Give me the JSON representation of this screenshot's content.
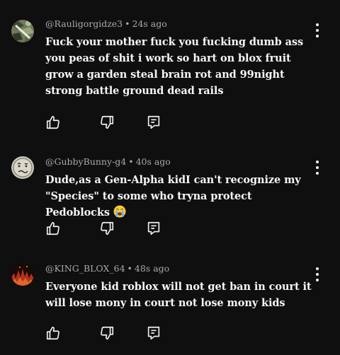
{
  "comments": [
    {
      "author": "@Rauligorgidze3",
      "time": "24s ago",
      "separator": "•",
      "text": "Fuck your mother fuck you fucking dumb ass you peas of shit i work so hart on blox fruit grow a garden steal brain rot and 99night strong battle ground dead rails",
      "avatar": "camouflage-avatar",
      "emoji": ""
    },
    {
      "author": "@GubbyBunny-g4",
      "time": "40s ago",
      "separator": "•",
      "text": "Dude,as a Gen-Alpha kidI can't recognize my \"Species\" to some who tryna protect Pedoblocks",
      "avatar": "confused-face-avatar",
      "emoji": "crying-face-emoji"
    },
    {
      "author": "@KING_BLOX_64",
      "time": "48s ago",
      "separator": "•",
      "text": "Everyone kid roblox will not get ban in court it will lose mony in court not lose mony kids",
      "avatar": "fire-avatar",
      "emoji": ""
    }
  ],
  "colors": {
    "background": "#0f0f0f",
    "text": "#f1f1f1",
    "meta": "#aaaaaa"
  },
  "icons": [
    "like-icon",
    "dislike-icon",
    "reply-icon",
    "more-options-icon"
  ]
}
